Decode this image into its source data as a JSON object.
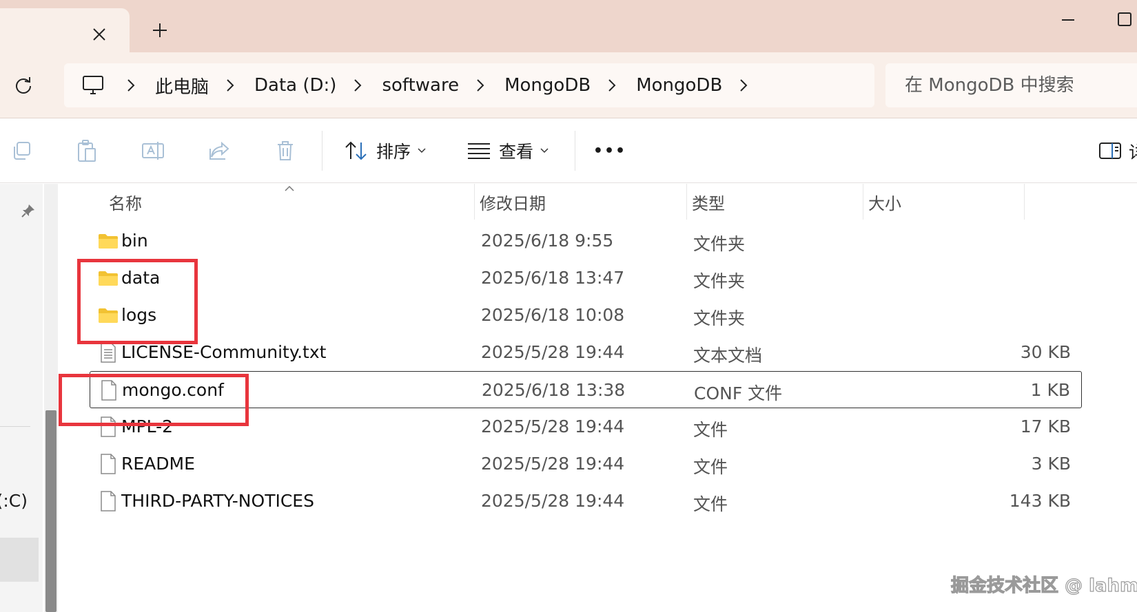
{
  "titlebar": {
    "close_tab_icon": "close-icon",
    "new_tab_icon": "plus-icon",
    "minimize_icon": "minimize-icon",
    "maximize_icon": "maximize-icon"
  },
  "address": {
    "refresh_icon": "refresh-icon",
    "root_icon": "computer-icon",
    "crumbs": [
      "此电脑",
      "Data (D:)",
      "software",
      "MongoDB",
      "MongoDB"
    ],
    "search_placeholder": "在 MongoDB 中搜索"
  },
  "commandbar": {
    "icons": [
      "copy-icon",
      "paste-icon",
      "rename-icon",
      "share-icon",
      "delete-icon"
    ],
    "sort_label": "排序",
    "view_label": "查看",
    "more_label": "•••",
    "details_label": "详"
  },
  "navpane": {
    "drive_label": "(C:)"
  },
  "columns": {
    "name": "名称",
    "date": "修改日期",
    "type": "类型",
    "size": "大小"
  },
  "files": [
    {
      "name": "bin",
      "date": "2025/6/18 9:55",
      "type": "文件夹",
      "size": "",
      "icon": "folder-icon"
    },
    {
      "name": "data",
      "date": "2025/6/18 13:47",
      "type": "文件夹",
      "size": "",
      "icon": "folder-icon"
    },
    {
      "name": "logs",
      "date": "2025/6/18 10:08",
      "type": "文件夹",
      "size": "",
      "icon": "folder-icon"
    },
    {
      "name": "LICENSE-Community.txt",
      "date": "2025/5/28 19:44",
      "type": "文本文档",
      "size": "30 KB",
      "icon": "text-file-icon"
    },
    {
      "name": "mongo.conf",
      "date": "2025/6/18 13:38",
      "type": "CONF 文件",
      "size": "1 KB",
      "icon": "file-icon"
    },
    {
      "name": "MPL-2",
      "date": "2025/5/28 19:44",
      "type": "文件",
      "size": "17 KB",
      "icon": "file-icon"
    },
    {
      "name": "README",
      "date": "2025/5/28 19:44",
      "type": "文件",
      "size": "3 KB",
      "icon": "file-icon"
    },
    {
      "name": "THIRD-PARTY-NOTICES",
      "date": "2025/5/28 19:44",
      "type": "文件",
      "size": "143 KB",
      "icon": "file-icon"
    }
  ],
  "colors": {
    "titlebar": "#eed6cc",
    "toolbar": "#f9efe9",
    "annotation": "#e8353d"
  },
  "watermark": "掘金技术社区 @ lahm"
}
